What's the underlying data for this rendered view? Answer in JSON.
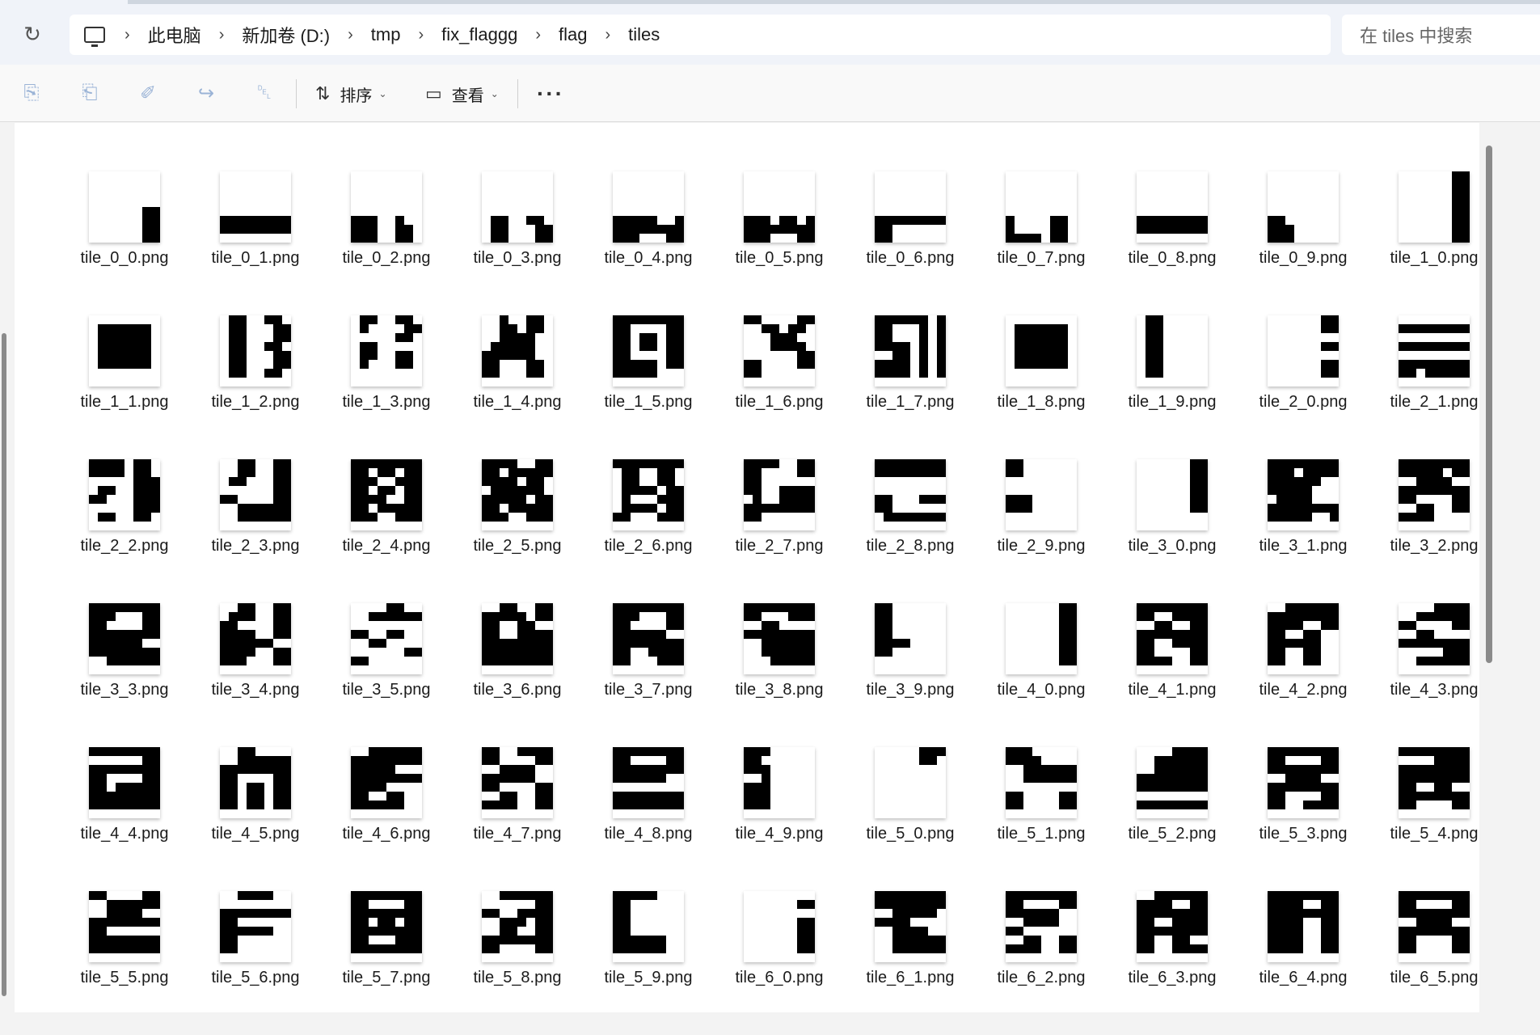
{
  "breadcrumb": [
    "此电脑",
    "新加卷 (D:)",
    "tmp",
    "fix_flaggg",
    "flag",
    "tiles"
  ],
  "search": {
    "placeholder": "在 tiles 中搜索"
  },
  "toolbar": {
    "icons": [
      "copy-icon",
      "paste-icon",
      "rename-icon",
      "share-icon",
      "delete-icon"
    ],
    "sort_label": "排序",
    "view_label": "查看",
    "more_label": "···"
  },
  "files": [
    {
      "name": "tile_0_0.png",
      "rows": [
        "00000000",
        "00000000",
        "00000000",
        "00000000",
        "00000011",
        "00000011",
        "00000011",
        "00000011"
      ]
    },
    {
      "name": "tile_0_1.png",
      "rows": [
        "00000000",
        "00000000",
        "00000000",
        "00000000",
        "00000000",
        "11111111",
        "11111111",
        "00000000"
      ]
    },
    {
      "name": "tile_0_2.png",
      "rows": [
        "00000000",
        "00000000",
        "00000000",
        "00000000",
        "00000000",
        "11100100",
        "11100110",
        "11100110"
      ]
    },
    {
      "name": "tile_0_3.png",
      "rows": [
        "00000000",
        "00000000",
        "00000000",
        "00000000",
        "00000000",
        "01100110",
        "01100011",
        "01100011"
      ]
    },
    {
      "name": "tile_0_4.png",
      "rows": [
        "00000000",
        "00000000",
        "00000000",
        "00000000",
        "00000000",
        "11111001",
        "11111111",
        "11100011"
      ]
    },
    {
      "name": "tile_0_5.png",
      "rows": [
        "00000000",
        "00000000",
        "00000000",
        "00000000",
        "00000000",
        "11101101",
        "11111111",
        "11100011"
      ]
    },
    {
      "name": "tile_0_6.png",
      "rows": [
        "00000000",
        "00000000",
        "00000000",
        "00000000",
        "00000000",
        "11111111",
        "11000000",
        "11000000"
      ]
    },
    {
      "name": "tile_0_7.png",
      "rows": [
        "00000000",
        "00000000",
        "00000000",
        "00000000",
        "00000000",
        "10000110",
        "10000110",
        "11110110"
      ]
    },
    {
      "name": "tile_0_8.png",
      "rows": [
        "00000000",
        "00000000",
        "00000000",
        "00000000",
        "00000000",
        "11111111",
        "11111111",
        "00000000"
      ]
    },
    {
      "name": "tile_0_9.png",
      "rows": [
        "00000000",
        "00000000",
        "00000000",
        "00000000",
        "00000000",
        "11000000",
        "11100000",
        "11100000"
      ]
    },
    {
      "name": "tile_1_0.png",
      "rows": [
        "00000011",
        "00000011",
        "00000011",
        "00000011",
        "00000011",
        "00000011",
        "00000011",
        "00000011"
      ]
    },
    {
      "name": "tile_1_1.png",
      "rows": [
        "00000000",
        "01111110",
        "01111110",
        "01111110",
        "01111110",
        "01111110",
        "00000000",
        "00000000"
      ]
    },
    {
      "name": "tile_1_2.png",
      "rows": [
        "01100110",
        "01100011",
        "01100011",
        "01100110",
        "01100011",
        "01100011",
        "01100110",
        "00000000"
      ]
    },
    {
      "name": "tile_1_3.png",
      "rows": [
        "01100110",
        "01000011",
        "00000110",
        "01100000",
        "01100110",
        "01000110",
        "00000000",
        "00000000"
      ]
    },
    {
      "name": "tile_1_4.png",
      "rows": [
        "00100110",
        "00110110",
        "00111100",
        "01111100",
        "11111100",
        "11000110",
        "11000110",
        "00000000"
      ]
    },
    {
      "name": "tile_1_5.png",
      "rows": [
        "11111111",
        "11000011",
        "11011011",
        "11011011",
        "11000011",
        "11111011",
        "11111000",
        "00000000"
      ]
    },
    {
      "name": "tile_1_6.png",
      "rows": [
        "11000011",
        "00110110",
        "00011100",
        "00011110",
        "00000011",
        "11000011",
        "11000000",
        "00000000"
      ]
    },
    {
      "name": "tile_1_7.png",
      "rows": [
        "11111101",
        "11000101",
        "11000101",
        "11110101",
        "00110101",
        "11110101",
        "11110101",
        "00000000"
      ]
    },
    {
      "name": "tile_1_8.png",
      "rows": [
        "00000000",
        "01111110",
        "01111110",
        "01111110",
        "01111110",
        "01111110",
        "00000000",
        "00000000"
      ]
    },
    {
      "name": "tile_1_9.png",
      "rows": [
        "01100000",
        "01100000",
        "01100000",
        "01100000",
        "01100000",
        "01100000",
        "01100000",
        "00000000"
      ]
    },
    {
      "name": "tile_2_0.png",
      "rows": [
        "00000011",
        "00000011",
        "00000000",
        "00000011",
        "00000000",
        "00000011",
        "00000011",
        "00000000"
      ]
    },
    {
      "name": "tile_2_1.png",
      "rows": [
        "00000000",
        "11111111",
        "00000000",
        "11111111",
        "00000000",
        "11111111",
        "11011111",
        "00000000"
      ]
    },
    {
      "name": "tile_2_2.png",
      "rows": [
        "11110110",
        "11110110",
        "00000111",
        "01100111",
        "11000111",
        "00000111",
        "01100110",
        "00000000"
      ]
    },
    {
      "name": "tile_2_3.png",
      "rows": [
        "00110011",
        "00110011",
        "01100011",
        "00000011",
        "11000011",
        "00111111",
        "00111111",
        "00000000"
      ]
    },
    {
      "name": "tile_2_4.png",
      "rows": [
        "11111111",
        "11011011",
        "11100111",
        "11011011",
        "11110011",
        "11011111",
        "11100111",
        "00000000"
      ]
    },
    {
      "name": "tile_2_5.png",
      "rows": [
        "11110011",
        "11011111",
        "11110110",
        "01111110",
        "11111011",
        "11011111",
        "11100111",
        "00000000"
      ]
    },
    {
      "name": "tile_2_6.png",
      "rows": [
        "11111111",
        "01100110",
        "01100110",
        "01111011",
        "01000111",
        "01111011",
        "11000111",
        "00000000"
      ]
    },
    {
      "name": "tile_2_7.png",
      "rows": [
        "11110011",
        "11000011",
        "11000000",
        "11001111",
        "01001111",
        "11111111",
        "11000000",
        "00000000"
      ]
    },
    {
      "name": "tile_2_8.png",
      "rows": [
        "11111111",
        "11111111",
        "00000000",
        "00000000",
        "11000111",
        "11000000",
        "01111111",
        "00000000"
      ]
    },
    {
      "name": "tile_2_9.png",
      "rows": [
        "11000000",
        "11000000",
        "00000000",
        "00000000",
        "11100000",
        "11100000",
        "00000000",
        "00000000"
      ]
    },
    {
      "name": "tile_3_0.png",
      "rows": [
        "00000011",
        "00000011",
        "00000011",
        "00000011",
        "00000011",
        "00000011",
        "00000000",
        "00000000"
      ]
    },
    {
      "name": "tile_3_1.png",
      "rows": [
        "11111111",
        "11101111",
        "11111100",
        "11111000",
        "01111000",
        "11111111",
        "11111001",
        "00000000"
      ]
    },
    {
      "name": "tile_3_2.png",
      "rows": [
        "11111111",
        "11111011",
        "00111100",
        "11111111",
        "11000011",
        "00110011",
        "11110000",
        "00000000"
      ]
    },
    {
      "name": "tile_3_3.png",
      "rows": [
        "11111111",
        "11100011",
        "11000011",
        "11111111",
        "11111100",
        "11111111",
        "00111111",
        "00000000"
      ]
    },
    {
      "name": "tile_3_4.png",
      "rows": [
        "00110011",
        "01110011",
        "11000011",
        "11110011",
        "11111100",
        "11110011",
        "11100011",
        "00000000"
      ]
    },
    {
      "name": "tile_3_5.png",
      "rows": [
        "00001100",
        "00111111",
        "00000000",
        "11001100",
        "00110000",
        "00000011",
        "11000000",
        "00000000"
      ]
    },
    {
      "name": "tile_3_6.png",
      "rows": [
        "00110011",
        "11111011",
        "11001100",
        "11001111",
        "11111111",
        "11111111",
        "11111111",
        "00000000"
      ]
    },
    {
      "name": "tile_3_7.png",
      "rows": [
        "11111111",
        "11100011",
        "11000011",
        "11111100",
        "11111111",
        "11001111",
        "11000111",
        "00000000"
      ]
    },
    {
      "name": "tile_3_8.png",
      "rows": [
        "11111111",
        "11000111",
        "00110000",
        "11111111",
        "00111111",
        "00111111",
        "00011111",
        "00000000"
      ]
    },
    {
      "name": "tile_3_9.png",
      "rows": [
        "11000000",
        "11000000",
        "11000000",
        "11000000",
        "11110000",
        "11000000",
        "00000000",
        "00000000"
      ]
    },
    {
      "name": "tile_4_0.png",
      "rows": [
        "00000011",
        "00000011",
        "00000011",
        "00000011",
        "00000011",
        "00000011",
        "00000011",
        "00000000"
      ]
    },
    {
      "name": "tile_4_1.png",
      "rows": [
        "11111111",
        "11001111",
        "00110011",
        "11111111",
        "11001111",
        "11000011",
        "11110011",
        "00000000"
      ]
    },
    {
      "name": "tile_4_2.png",
      "rows": [
        "00111111",
        "11111111",
        "11110011",
        "11001100",
        "11111100",
        "11001100",
        "11001100",
        "00000000"
      ]
    },
    {
      "name": "tile_4_3.png",
      "rows": [
        "00001111",
        "00111111",
        "11000011",
        "00110000",
        "11111111",
        "00000111",
        "00111111",
        "00000000"
      ]
    },
    {
      "name": "tile_4_4.png",
      "rows": [
        "11111111",
        "00000011",
        "11111111",
        "11000011",
        "11011111",
        "11111111",
        "11111111",
        "00000000"
      ]
    },
    {
      "name": "tile_4_5.png",
      "rows": [
        "00110000",
        "00111111",
        "11111111",
        "11000011",
        "11011011",
        "11011011",
        "11011011",
        "00000000"
      ]
    },
    {
      "name": "tile_4_6.png",
      "rows": [
        "00111111",
        "11111111",
        "11111000",
        "11111111",
        "11110000",
        "11001100",
        "11111100",
        "00000000"
      ]
    },
    {
      "name": "tile_4_7.png",
      "rows": [
        "11001111",
        "11000011",
        "00111100",
        "11111100",
        "11000011",
        "00110011",
        "11110011",
        "00000000"
      ]
    },
    {
      "name": "tile_4_8.png",
      "rows": [
        "11111111",
        "11000011",
        "11111111",
        "11111100",
        "00000000",
        "11111111",
        "11111111",
        "00000000"
      ]
    },
    {
      "name": "tile_4_9.png",
      "rows": [
        "11100000",
        "11000000",
        "11100000",
        "00100000",
        "11100000",
        "11100000",
        "11100000",
        "00000000"
      ]
    },
    {
      "name": "tile_5_0.png",
      "rows": [
        "00000111",
        "00000110",
        "00000000",
        "00000000",
        "00000000",
        "00000000",
        "00000000",
        "00000000"
      ]
    },
    {
      "name": "tile_5_1.png",
      "rows": [
        "11100000",
        "11110000",
        "00111111",
        "00111111",
        "00000000",
        "11000011",
        "11000011",
        "00000000"
      ]
    },
    {
      "name": "tile_5_2.png",
      "rows": [
        "00001111",
        "00111111",
        "00111111",
        "11111111",
        "11111111",
        "00000000",
        "11111111",
        "00000000"
      ]
    },
    {
      "name": "tile_5_3.png",
      "rows": [
        "11111111",
        "11000011",
        "11111111",
        "00111100",
        "11111111",
        "11000011",
        "11001111",
        "00000000"
      ]
    },
    {
      "name": "tile_5_4.png",
      "rows": [
        "11111111",
        "00001111",
        "11111111",
        "11111111",
        "11001100",
        "11111111",
        "11000011",
        "00000000"
      ]
    },
    {
      "name": "tile_5_5.png",
      "rows": [
        "11000011",
        "00111111",
        "00111100",
        "11111111",
        "11000000",
        "11111111",
        "11111111",
        "00000000"
      ]
    },
    {
      "name": "tile_5_6.png",
      "rows": [
        "00111100",
        "00000000",
        "11111111",
        "11000000",
        "11111100",
        "11000000",
        "11000000",
        "00000000"
      ]
    },
    {
      "name": "tile_5_7.png",
      "rows": [
        "11111111",
        "11000011",
        "11111111",
        "11011011",
        "11111111",
        "11000111",
        "11111111",
        "00000000"
      ]
    },
    {
      "name": "tile_5_8.png",
      "rows": [
        "00111111",
        "00000011",
        "11001111",
        "00111011",
        "00110011",
        "11111111",
        "11000011",
        "00000000"
      ]
    },
    {
      "name": "tile_5_9.png",
      "rows": [
        "11111000",
        "11000000",
        "11000000",
        "11000000",
        "11000000",
        "11111100",
        "11111100",
        "00000000"
      ]
    },
    {
      "name": "tile_6_0.png",
      "rows": [
        "00000000",
        "00000011",
        "00000000",
        "00000011",
        "00000011",
        "00000011",
        "00000011",
        "00000000"
      ]
    },
    {
      "name": "tile_6_1.png",
      "rows": [
        "11111111",
        "11111111",
        "00111110",
        "11110000",
        "00111100",
        "00111111",
        "00111111",
        "00000000"
      ]
    },
    {
      "name": "tile_6_2.png",
      "rows": [
        "11111111",
        "11000011",
        "11111100",
        "00111100",
        "11000000",
        "00110011",
        "11110011",
        "00000000"
      ]
    },
    {
      "name": "tile_6_3.png",
      "rows": [
        "00111111",
        "11110011",
        "11111111",
        "11001111",
        "11111111",
        "11001100",
        "11001111",
        "00000000"
      ]
    },
    {
      "name": "tile_6_4.png",
      "rows": [
        "11111111",
        "11110011",
        "11111111",
        "11110011",
        "11110011",
        "11110011",
        "11110011",
        "00000000"
      ]
    },
    {
      "name": "tile_6_5.png",
      "rows": [
        "11111111",
        "11000011",
        "11111111",
        "00111100",
        "11111111",
        "11000011",
        "11000011",
        "00000000"
      ]
    }
  ]
}
